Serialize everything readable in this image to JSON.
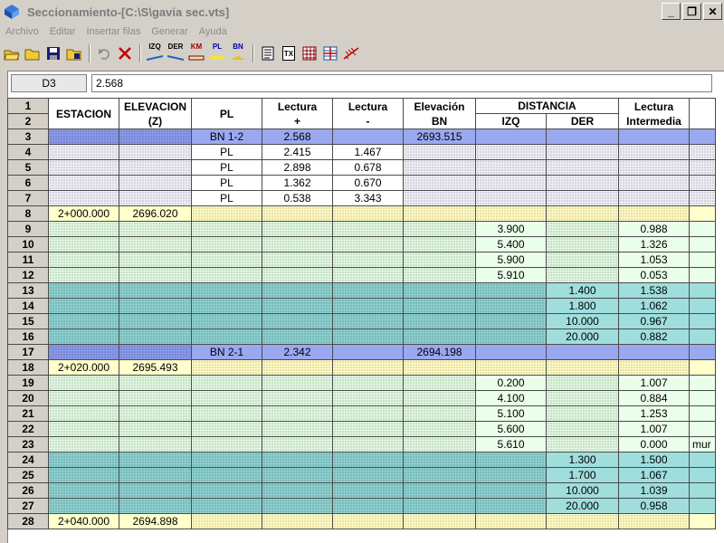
{
  "window": {
    "title": "Seccionamiento-[C:\\S\\gavia sec.vts]",
    "minimize": "_",
    "restore": "❐",
    "close": "✕"
  },
  "menu": [
    "Archivo",
    "Editar",
    "Insertar filas",
    "Generar",
    "Ayuda"
  ],
  "toolbar": {
    "izq": "IZQ",
    "der": "DER",
    "km": "KM",
    "pl": "PL",
    "bn": "BN",
    "tx": "TX"
  },
  "formula": {
    "cell": "D3",
    "value": "2.568"
  },
  "headers": {
    "row1": "1",
    "row2": "2",
    "estacion": "ESTACION",
    "elevacion": "ELEVACION",
    "elevacion_z": "(Z)",
    "pl": "PL",
    "lectura_plus_1": "Lectura",
    "lectura_plus_2": "+",
    "lectura_minus_1": "Lectura",
    "lectura_minus_2": "-",
    "elevbn_1": "Elevación",
    "elevbn_2": "BN",
    "distancia": "DISTANCIA",
    "izq": "IZQ",
    "der": "DER",
    "lint_1": "Lectura",
    "lint_2": "Intermedia"
  },
  "rows": [
    {
      "n": "3",
      "type": "bn",
      "est": "",
      "elev": "",
      "pl": "BN 1-2",
      "lp": "2.568",
      "lm": "",
      "bn": "2693.515",
      "izq": "",
      "der": "",
      "li": "",
      "x": ""
    },
    {
      "n": "4",
      "type": "pl",
      "est": "",
      "elev": "",
      "pl": "PL",
      "lp": "2.415",
      "lm": "1.467",
      "bn": "",
      "izq": "",
      "der": "",
      "li": "",
      "x": ""
    },
    {
      "n": "5",
      "type": "pl",
      "est": "",
      "elev": "",
      "pl": "PL",
      "lp": "2.898",
      "lm": "0.678",
      "bn": "",
      "izq": "",
      "der": "",
      "li": "",
      "x": ""
    },
    {
      "n": "6",
      "type": "pl",
      "est": "",
      "elev": "",
      "pl": "PL",
      "lp": "1.362",
      "lm": "0.670",
      "bn": "",
      "izq": "",
      "der": "",
      "li": "",
      "x": ""
    },
    {
      "n": "7",
      "type": "pl",
      "est": "",
      "elev": "",
      "pl": "PL",
      "lp": "0.538",
      "lm": "3.343",
      "bn": "",
      "izq": "",
      "der": "",
      "li": "",
      "x": ""
    },
    {
      "n": "8",
      "type": "st",
      "est": "2+000.000",
      "elev": "2696.020",
      "pl": "",
      "lp": "",
      "lm": "",
      "bn": "",
      "izq": "",
      "der": "",
      "li": "",
      "x": ""
    },
    {
      "n": "9",
      "type": "iz",
      "est": "",
      "elev": "",
      "pl": "",
      "lp": "",
      "lm": "",
      "bn": "",
      "izq": "3.900",
      "der": "",
      "li": "0.988",
      "x": ""
    },
    {
      "n": "10",
      "type": "iz",
      "est": "",
      "elev": "",
      "pl": "",
      "lp": "",
      "lm": "",
      "bn": "",
      "izq": "5.400",
      "der": "",
      "li": "1.326",
      "x": ""
    },
    {
      "n": "11",
      "type": "iz",
      "est": "",
      "elev": "",
      "pl": "",
      "lp": "",
      "lm": "",
      "bn": "",
      "izq": "5.900",
      "der": "",
      "li": "1.053",
      "x": ""
    },
    {
      "n": "12",
      "type": "iz",
      "est": "",
      "elev": "",
      "pl": "",
      "lp": "",
      "lm": "",
      "bn": "",
      "izq": "5.910",
      "der": "",
      "li": "0.053",
      "x": ""
    },
    {
      "n": "13",
      "type": "de",
      "est": "",
      "elev": "",
      "pl": "",
      "lp": "",
      "lm": "",
      "bn": "",
      "izq": "",
      "der": "1.400",
      "li": "1.538",
      "x": ""
    },
    {
      "n": "14",
      "type": "de",
      "est": "",
      "elev": "",
      "pl": "",
      "lp": "",
      "lm": "",
      "bn": "",
      "izq": "",
      "der": "1.800",
      "li": "1.062",
      "x": ""
    },
    {
      "n": "15",
      "type": "de",
      "est": "",
      "elev": "",
      "pl": "",
      "lp": "",
      "lm": "",
      "bn": "",
      "izq": "",
      "der": "10.000",
      "li": "0.967",
      "x": ""
    },
    {
      "n": "16",
      "type": "de",
      "est": "",
      "elev": "",
      "pl": "",
      "lp": "",
      "lm": "",
      "bn": "",
      "izq": "",
      "der": "20.000",
      "li": "0.882",
      "x": ""
    },
    {
      "n": "17",
      "type": "bn",
      "est": "",
      "elev": "",
      "pl": "BN 2-1",
      "lp": "2.342",
      "lm": "",
      "bn": "2694.198",
      "izq": "",
      "der": "",
      "li": "",
      "x": ""
    },
    {
      "n": "18",
      "type": "st",
      "est": "2+020.000",
      "elev": "2695.493",
      "pl": "",
      "lp": "",
      "lm": "",
      "bn": "",
      "izq": "",
      "der": "",
      "li": "",
      "x": ""
    },
    {
      "n": "19",
      "type": "iz",
      "est": "",
      "elev": "",
      "pl": "",
      "lp": "",
      "lm": "",
      "bn": "",
      "izq": "0.200",
      "der": "",
      "li": "1.007",
      "x": ""
    },
    {
      "n": "20",
      "type": "iz",
      "est": "",
      "elev": "",
      "pl": "",
      "lp": "",
      "lm": "",
      "bn": "",
      "izq": "4.100",
      "der": "",
      "li": "0.884",
      "x": ""
    },
    {
      "n": "21",
      "type": "iz",
      "est": "",
      "elev": "",
      "pl": "",
      "lp": "",
      "lm": "",
      "bn": "",
      "izq": "5.100",
      "der": "",
      "li": "1.253",
      "x": ""
    },
    {
      "n": "22",
      "type": "iz",
      "est": "",
      "elev": "",
      "pl": "",
      "lp": "",
      "lm": "",
      "bn": "",
      "izq": "5.600",
      "der": "",
      "li": "1.007",
      "x": ""
    },
    {
      "n": "23",
      "type": "iz",
      "est": "",
      "elev": "",
      "pl": "",
      "lp": "",
      "lm": "",
      "bn": "",
      "izq": "5.610",
      "der": "",
      "li": "0.000",
      "x": "mur"
    },
    {
      "n": "24",
      "type": "de",
      "est": "",
      "elev": "",
      "pl": "",
      "lp": "",
      "lm": "",
      "bn": "",
      "izq": "",
      "der": "1.300",
      "li": "1.500",
      "x": ""
    },
    {
      "n": "25",
      "type": "de",
      "est": "",
      "elev": "",
      "pl": "",
      "lp": "",
      "lm": "",
      "bn": "",
      "izq": "",
      "der": "1.700",
      "li": "1.067",
      "x": ""
    },
    {
      "n": "26",
      "type": "de",
      "est": "",
      "elev": "",
      "pl": "",
      "lp": "",
      "lm": "",
      "bn": "",
      "izq": "",
      "der": "10.000",
      "li": "1.039",
      "x": ""
    },
    {
      "n": "27",
      "type": "de",
      "est": "",
      "elev": "",
      "pl": "",
      "lp": "",
      "lm": "",
      "bn": "",
      "izq": "",
      "der": "20.000",
      "li": "0.958",
      "x": ""
    },
    {
      "n": "28",
      "type": "st",
      "est": "2+040.000",
      "elev": "2694.898",
      "pl": "",
      "lp": "",
      "lm": "",
      "bn": "",
      "izq": "",
      "der": "",
      "li": "",
      "x": ""
    }
  ]
}
